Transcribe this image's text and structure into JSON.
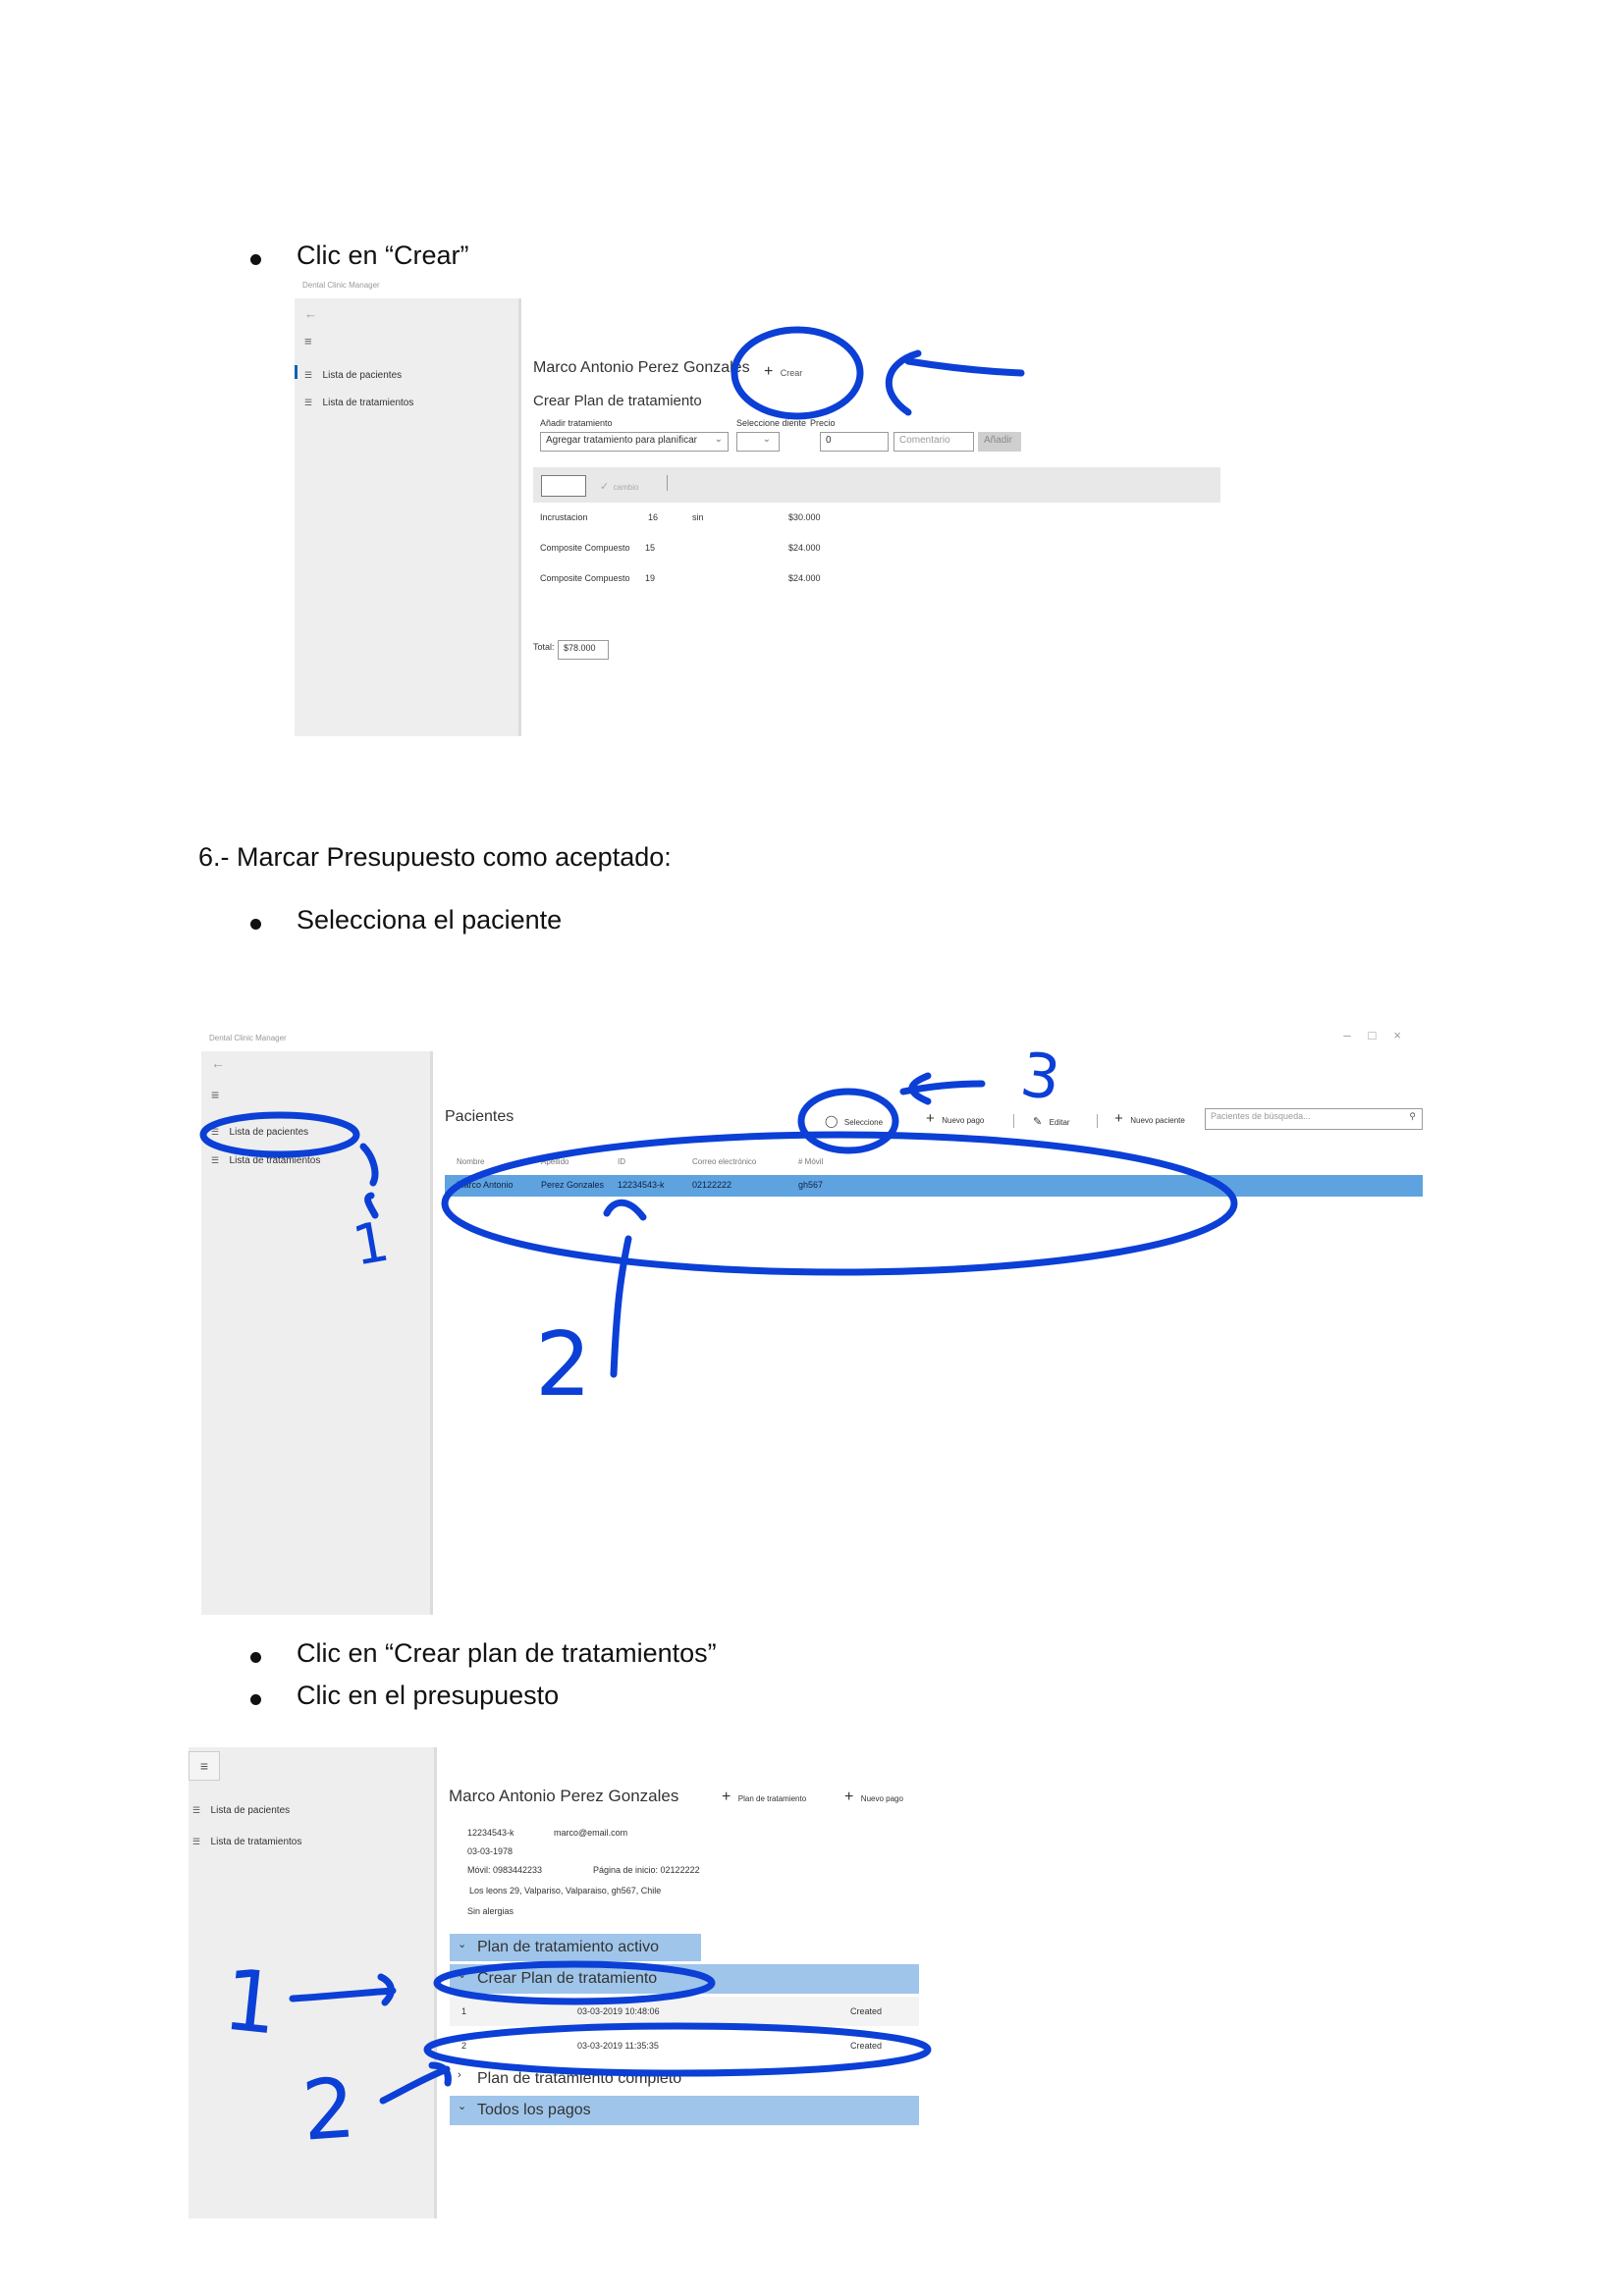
{
  "doc": {
    "bullet_crear": "Clic en “Crear”",
    "heading_6": "6.- Marcar Presupuesto como aceptado:",
    "bullet_selecciona": "Selecciona el paciente",
    "bullet_crear_plan": "Clic en “Crear plan de tratamientos”",
    "bullet_presupuesto": "Clic en el presupuesto"
  },
  "shot1": {
    "app_title": "Dental Clinic Manager",
    "nav": [
      "Lista de pacientes",
      "Lista de tratamientos"
    ],
    "patient_name": "Marco Antonio Perez Gonzales",
    "crear_label": "Crear",
    "section_title": "Crear Plan de tratamiento",
    "add_treatment_label": "Añadir tratamiento",
    "select_tooth_label": "Seleccione diente",
    "price_label": "Precio",
    "treatment_dropdown": "Agregar tratamiento para planificar",
    "price_value": "0",
    "comment_placeholder": "Comentario",
    "add_button": "Añadir",
    "cambio_label": "cambio",
    "rows": [
      {
        "name": "Incrustacion",
        "tooth": "16",
        "comment": "sin",
        "price": "$30.000"
      },
      {
        "name": "Composite Compuesto",
        "tooth": "15",
        "comment": "",
        "price": "$24.000"
      },
      {
        "name": "Composite Compuesto",
        "tooth": "19",
        "comment": "",
        "price": "$24.000"
      }
    ],
    "total_label": "Total:",
    "total_value": "$78.000"
  },
  "shot2": {
    "app_title": "Dental Clinic Manager",
    "nav": [
      "Lista de pacientes",
      "Lista de tratamientos"
    ],
    "page_title": "Pacientes",
    "toolbar": {
      "seleccione": "Seleccione",
      "nuevo_pago": "Nuevo pago",
      "editar": "Editar",
      "nuevo_paciente": "Nuevo paciente",
      "search_placeholder": "Pacientes de búsqueda..."
    },
    "columns": [
      "Nombre",
      "Apellido",
      "ID",
      "Correo electrónico",
      "# Móvil"
    ],
    "row": [
      "Marco Antonio",
      "Perez Gonzales",
      "12234543-k",
      "02122222",
      "gh567"
    ]
  },
  "shot3": {
    "nav": [
      "Lista de pacientes",
      "Lista de tratamientos"
    ],
    "patient_name": "Marco Antonio Perez Gonzales",
    "plan_button": "Plan de tratamiento",
    "nuevo_pago": "Nuevo pago",
    "id": "12234543-k",
    "email": "marco@email.com",
    "birth": "03-03-1978",
    "movil": "Móvil: 0983442233",
    "pagina": "Página de inicio: 02122222",
    "address": "Los leons 29, Valpariso, Valparaiso, gh567, Chile",
    "allergies": "Sin alergias",
    "sections": {
      "activo": "Plan de tratamiento activo",
      "crear": "Crear Plan de tratamiento",
      "completo": "Plan de tratamiento completo",
      "pagos": "Todos los pagos"
    },
    "plans": [
      {
        "num": "1",
        "date": "03-03-2019 10:48:06",
        "status": "Created"
      },
      {
        "num": "2",
        "date": "03-03-2019 11:35:35",
        "status": "Created"
      }
    ]
  },
  "annotations": {
    "num_1": "1",
    "num_2": "2",
    "num_3": "3"
  },
  "colors": {
    "ink": "#0b3fd6",
    "selection": "#5ea3e0",
    "section_header": "#9fc5ea",
    "accent": "#0063b1"
  }
}
